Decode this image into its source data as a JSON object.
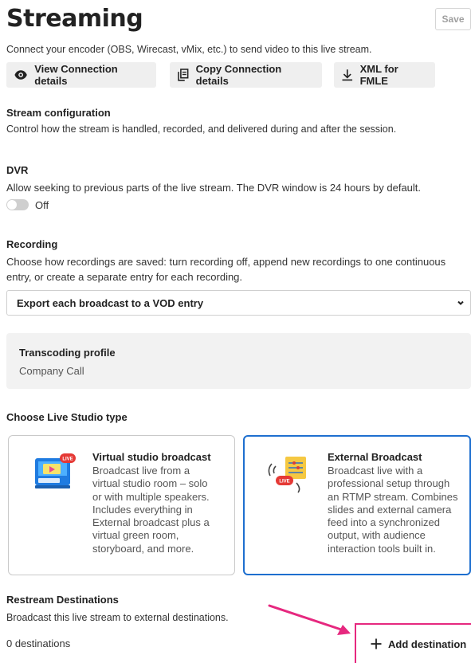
{
  "page": {
    "title": "Streaming",
    "save_label": "Save"
  },
  "connection": {
    "description": "Connect your encoder (OBS, Wirecast, vMix, etc.) to send video to this live stream.",
    "buttons": [
      {
        "label": "View Connection details",
        "icon": "eye-icon"
      },
      {
        "label": "Copy Connection details",
        "icon": "copy-icon"
      },
      {
        "label": "XML for FMLE",
        "icon": "download-icon"
      }
    ]
  },
  "stream_config": {
    "title": "Stream configuration",
    "description": "Control how the stream is handled, recorded, and delivered during and after the session."
  },
  "dvr": {
    "title": "DVR",
    "description": "Allow seeking to previous parts of the live stream. The DVR window is 24 hours by default.",
    "toggle_label": "Off",
    "enabled": false
  },
  "recording": {
    "title": "Recording",
    "description_line1": "Choose how recordings are saved: turn recording off, append new recordings to one continuous",
    "description_line2": "entry, or create a separate entry for each recording.",
    "selected": "Export each broadcast to a VOD entry"
  },
  "transcoding": {
    "title": "Transcoding profile",
    "value": "Company Call"
  },
  "studio": {
    "title": "Choose Live Studio type",
    "options": [
      {
        "title": "Virtual studio broadcast",
        "description": "Broadcast live from a\nvirtual studio room – solo\nor with multiple speakers.\nIncludes everything in\nExternal broadcast plus a\nvirtual green room,\nstoryboard, and more.",
        "icon_badge": "LIVE",
        "selected": false
      },
      {
        "title": "External Broadcast",
        "description": "Broadcast live with a\nprofessional setup through\nan RTMP stream. Combines\nslides and external camera\nfeed into a synchronized\noutput, with audience\ninteraction tools built in.",
        "icon_badge": "LIVE",
        "selected": true
      }
    ]
  },
  "restream": {
    "title": "Restream Destinations",
    "description": "Broadcast this live stream to external destinations.",
    "count_label": "0 destinations",
    "add_label": "Add destination"
  },
  "colors": {
    "accent": "#1e6fcf",
    "highlight": "#e6287f",
    "badge_red": "#e53935",
    "card_yellow": "#f5c842"
  }
}
